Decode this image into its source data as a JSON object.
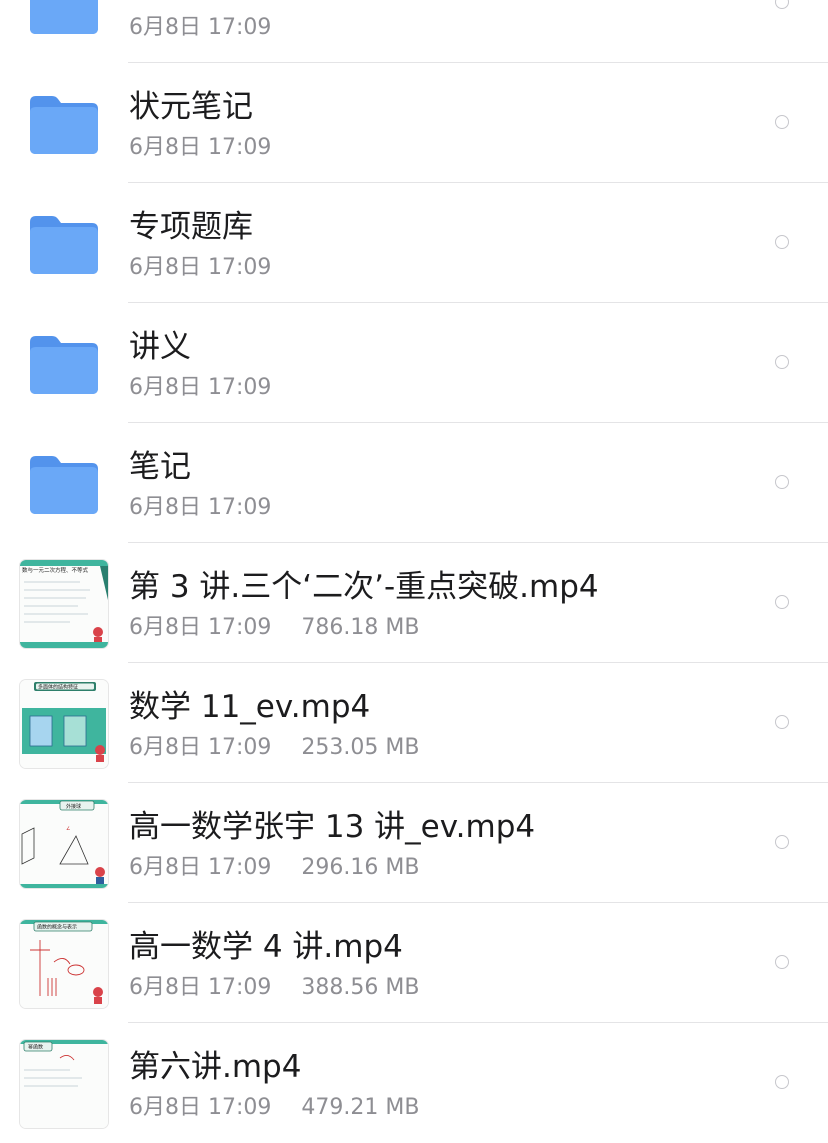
{
  "items": [
    {
      "kind": "folder",
      "title": "",
      "date": "6月8日 17:09",
      "size": ""
    },
    {
      "kind": "folder",
      "title": "状元笔记",
      "date": "6月8日 17:09",
      "size": ""
    },
    {
      "kind": "folder",
      "title": "专项题库",
      "date": "6月8日 17:09",
      "size": ""
    },
    {
      "kind": "folder",
      "title": "讲义",
      "date": "6月8日 17:09",
      "size": ""
    },
    {
      "kind": "folder",
      "title": "笔记",
      "date": "6月8日 17:09",
      "size": ""
    },
    {
      "kind": "video",
      "title": "第 3 讲.三个‘二次’-重点突破.mp4",
      "date": "6月8日 17:09",
      "size": "786.18 MB",
      "thumb_caption": "数与一元二次方程、不等式"
    },
    {
      "kind": "video",
      "title": "数学 11_ev.mp4",
      "date": "6月8日 17:09",
      "size": "253.05 MB",
      "thumb_caption": "多面体的结构特征"
    },
    {
      "kind": "video",
      "title": "高一数学张宇 13 讲_ev.mp4",
      "date": "6月8日 17:09",
      "size": "296.16 MB",
      "thumb_caption": "外接球"
    },
    {
      "kind": "video",
      "title": "高一数学 4 讲.mp4",
      "date": "6月8日 17:09",
      "size": "388.56 MB",
      "thumb_caption": "函数的概念与表示"
    },
    {
      "kind": "video",
      "title": "第六讲.mp4",
      "date": "6月8日 17:09",
      "size": "479.21 MB",
      "thumb_caption": "幂函数"
    }
  ],
  "colors": {
    "folder": "#6aa8f7",
    "folder_tab": "#5393ec",
    "thumb_accent": "#3fb59e"
  },
  "icons": {
    "folder": "folder-icon",
    "select": "select-circle-icon",
    "thumbnail": "video-thumbnail"
  }
}
